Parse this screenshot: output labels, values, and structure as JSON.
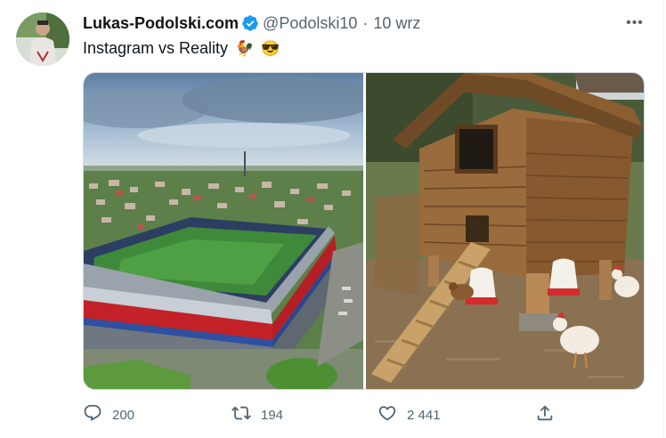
{
  "tweet": {
    "display_name": "Lukas-Podolski.com",
    "handle": "@Podolski10",
    "separator": "·",
    "time": "10 wrz",
    "text": "Instagram vs Reality",
    "emojis": [
      "🐓",
      "😎"
    ],
    "more_label": "•••",
    "verified_color": "#1d9bf0"
  },
  "actions": {
    "reply_count": "200",
    "retweet_count": "194",
    "like_count": "2 441"
  },
  "icons": {
    "more": "more-icon",
    "verified": "verified-badge-icon",
    "reply": "reply-icon",
    "retweet": "retweet-icon",
    "like": "like-icon",
    "share": "share-icon"
  }
}
